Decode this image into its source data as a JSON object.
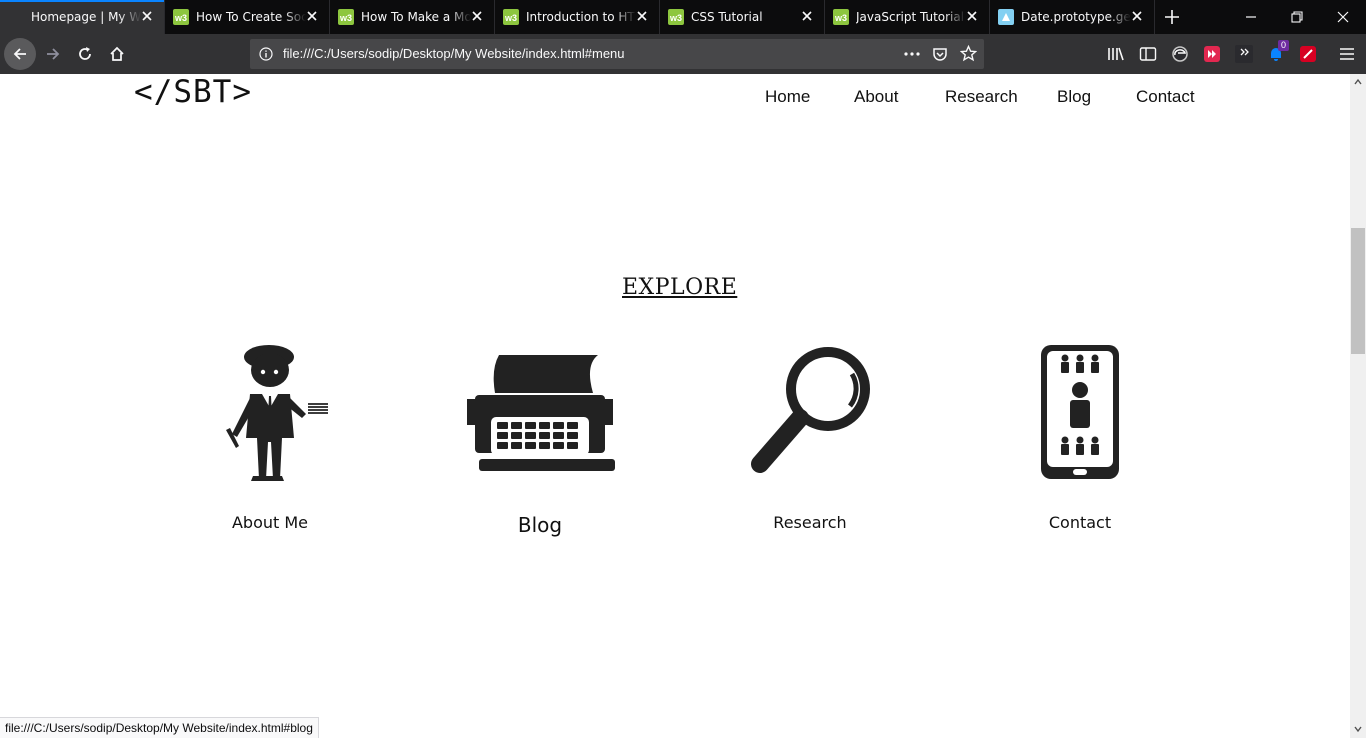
{
  "tabs": [
    {
      "title": "Homepage | My Website",
      "favicon": "page-icon",
      "active": true
    },
    {
      "title": "How To Create Social",
      "favicon": "w3schools-icon",
      "active": false
    },
    {
      "title": "How To Make a Mobile",
      "favicon": "w3schools-icon",
      "active": false
    },
    {
      "title": "Introduction to HTML",
      "favicon": "w3schools-icon",
      "active": false
    },
    {
      "title": "CSS Tutorial",
      "favicon": "w3schools-icon",
      "active": false
    },
    {
      "title": "JavaScript Tutorial",
      "favicon": "w3schools-icon",
      "active": false
    },
    {
      "title": "Date.prototype.getFullYear",
      "favicon": "mdn-icon",
      "active": false
    }
  ],
  "address": {
    "url": "file:///C:/Users/sodip/Desktop/My Website/index.html#menu"
  },
  "toolbar": {
    "notification_count": "0"
  },
  "site": {
    "logo": "</SBT>",
    "nav": [
      "Home",
      "About",
      "Research",
      "Blog",
      "Contact"
    ],
    "section_title": "EXPLORE",
    "cards": [
      {
        "label": "About Me",
        "icon": "businessman-icon"
      },
      {
        "label": "Blog",
        "icon": "typewriter-icon"
      },
      {
        "label": "Research",
        "icon": "magnifier-icon"
      },
      {
        "label": "Contact",
        "icon": "phone-contacts-icon"
      }
    ]
  },
  "status_bar": {
    "text": "file:///C:/Users/sodip/Desktop/My Website/index.html#blog"
  },
  "colors": {
    "tab_bar": "#0c0c0d",
    "nav_bar": "#323234",
    "url_field": "#474749",
    "active_tab_indicator": "#0a84ff",
    "w3_green": "#8dc63f"
  }
}
